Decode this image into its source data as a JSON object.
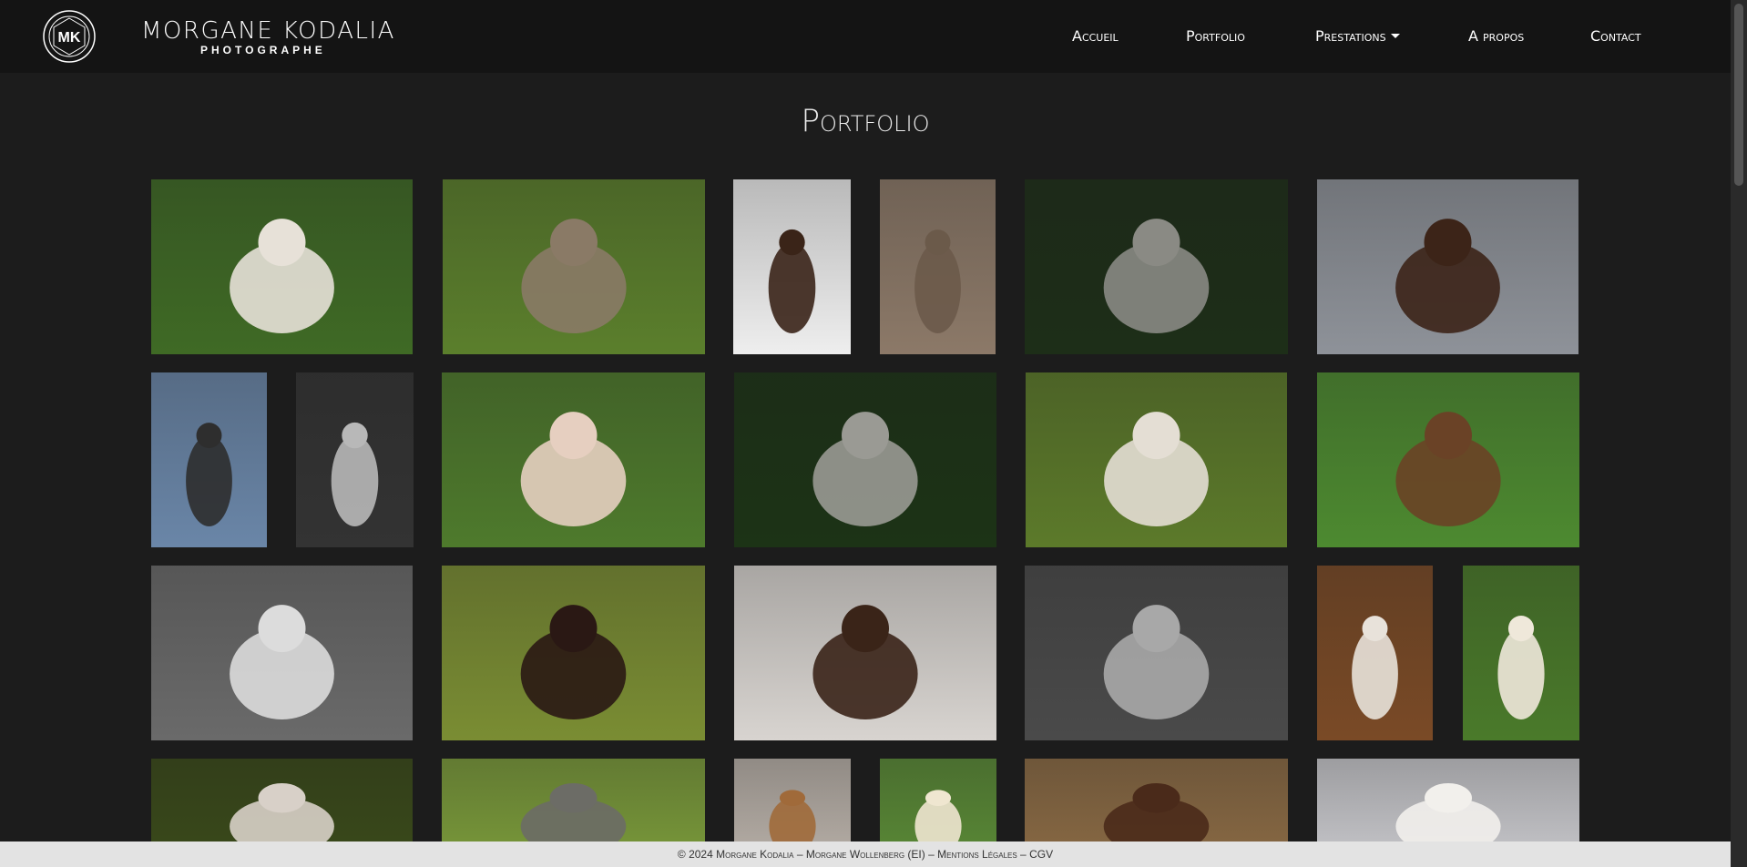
{
  "brand": {
    "name": "MORGANE KODALIA",
    "subtitle": "PHOTOGRAPHE",
    "logo_letters": "MK"
  },
  "nav": {
    "accueil": "Accueil",
    "portfolio": "Portfolio",
    "prestations": "Prestations",
    "apropos": "A propos",
    "contact": "Contact"
  },
  "page": {
    "title": "Portfolio"
  },
  "footer": {
    "copyright": "© 2024 Morgane Kodalia",
    "sep1": "–",
    "owner": "Morgane Wollenberg (EI)",
    "sep2": "–",
    "legal": "Mentions Légales",
    "sep3": "–",
    "cgv": "CGV"
  },
  "photos": [
    {
      "subject": "jack-russell-terrier",
      "bg": "#3f6a25",
      "accent": "#e7e1d8"
    },
    {
      "subject": "tabby-cat-grass",
      "bg": "#5b7f2c",
      "accent": "#8a7a66"
    },
    {
      "subject": "chocolate-labrador-snow",
      "bg": "#eeeeee",
      "accent": "#3a2418"
    },
    {
      "subject": "tabby-cat-rock",
      "bg": "#8c7968",
      "accent": "#6b5a4a"
    },
    {
      "subject": "donkeys-bokeh",
      "bg": "#1d2e18",
      "accent": "#8a8a84"
    },
    {
      "subject": "chocolate-labrador-lake",
      "bg": "#8e9299",
      "accent": "#3c2418"
    },
    {
      "subject": "dog-beach-reflection",
      "bg": "#6a86a8",
      "accent": "#2e2e2e"
    },
    {
      "subject": "cat-black-white",
      "bg": "#333333",
      "accent": "#b8b8b8"
    },
    {
      "subject": "spaniel-puppy",
      "bg": "#4e7a2c",
      "accent": "#e6cfc0"
    },
    {
      "subject": "donkeys-playing",
      "bg": "#1c3316",
      "accent": "#9a9a94"
    },
    {
      "subject": "terrier-sunset-field",
      "bg": "#5c7a2a",
      "accent": "#e4ded4"
    },
    {
      "subject": "brown-goat",
      "bg": "#4d8a30",
      "accent": "#6a4226"
    },
    {
      "subject": "woman-golden-retriever-bw",
      "bg": "#6a6a6a",
      "accent": "#dcdcdc"
    },
    {
      "subject": "black-cat-field",
      "bg": "#7a8d33",
      "accent": "#2a1814"
    },
    {
      "subject": "labrador-snow-forest",
      "bg": "#d8d4d0",
      "accent": "#3a2418"
    },
    {
      "subject": "cat-stool-bw",
      "bg": "#4a4a4a",
      "accent": "#a8a8a8"
    },
    {
      "subject": "terrier-autumn-leaves",
      "bg": "#7a4a26",
      "accent": "#e8e2da"
    },
    {
      "subject": "golden-retriever-clover",
      "bg": "#4a7a2a",
      "accent": "#efe8da"
    },
    {
      "subject": "terrier-sunset",
      "bg": "#3a4a1a",
      "accent": "#d8d0c8"
    },
    {
      "subject": "donkey-forest",
      "bg": "#7a9a3a",
      "accent": "#6c6c66"
    },
    {
      "subject": "terrier-snow",
      "bg": "#b8b0a8",
      "accent": "#a06a3a"
    },
    {
      "subject": "golden-retriever-puppy",
      "bg": "#5a8a36",
      "accent": "#efe6d0"
    },
    {
      "subject": "autumn-forest-dog",
      "bg": "#8a6a44",
      "accent": "#4a2a1a"
    },
    {
      "subject": "terrier-grey",
      "bg": "#c8c8cc",
      "accent": "#f2f0ec"
    }
  ]
}
